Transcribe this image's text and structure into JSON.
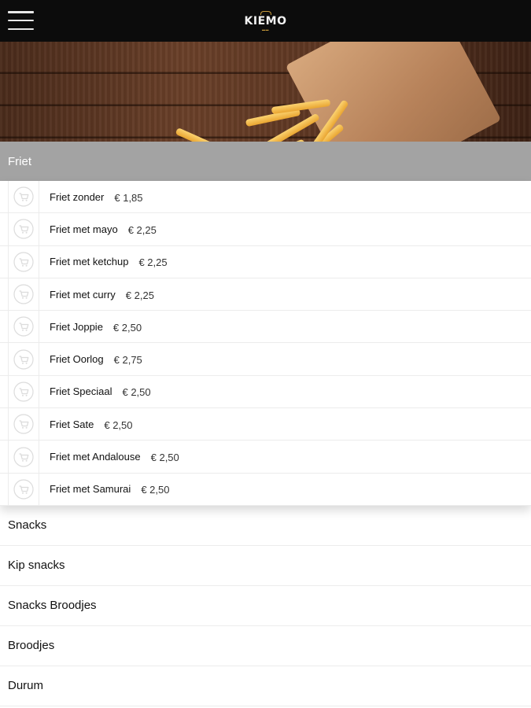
{
  "brand": {
    "name": "KIEMO"
  },
  "header": {
    "menu_icon": "hamburger-icon"
  },
  "hero": {
    "image": "fries-in-paper-cone-on-wooden-table"
  },
  "active_category": {
    "label": "Friet",
    "items": [
      {
        "name": "Friet zonder",
        "price": "€ 1,85"
      },
      {
        "name": "Friet met mayo",
        "price": "€ 2,25"
      },
      {
        "name": "Friet met ketchup",
        "price": "€ 2,25"
      },
      {
        "name": "Friet met curry",
        "price": "€ 2,25"
      },
      {
        "name": "Friet Joppie",
        "price": "€ 2,50"
      },
      {
        "name": "Friet Oorlog",
        "price": "€ 2,75"
      },
      {
        "name": "Friet Speciaal",
        "price": "€ 2,50"
      },
      {
        "name": "Friet Sate",
        "price": "€ 2,50"
      },
      {
        "name": "Friet met Andalouse",
        "price": "€ 2,50"
      },
      {
        "name": "Friet met Samurai",
        "price": "€ 2,50"
      }
    ],
    "item_icon": "add-to-cart-icon"
  },
  "categories": [
    {
      "label": "Snacks"
    },
    {
      "label": "Kip snacks"
    },
    {
      "label": "Snacks Broodjes"
    },
    {
      "label": "Broodjes"
    },
    {
      "label": "Durum"
    }
  ],
  "colors": {
    "topbar": "#0c0c0c",
    "category_header": "#a3a3a3",
    "brand_accent": "#c79a3a"
  }
}
